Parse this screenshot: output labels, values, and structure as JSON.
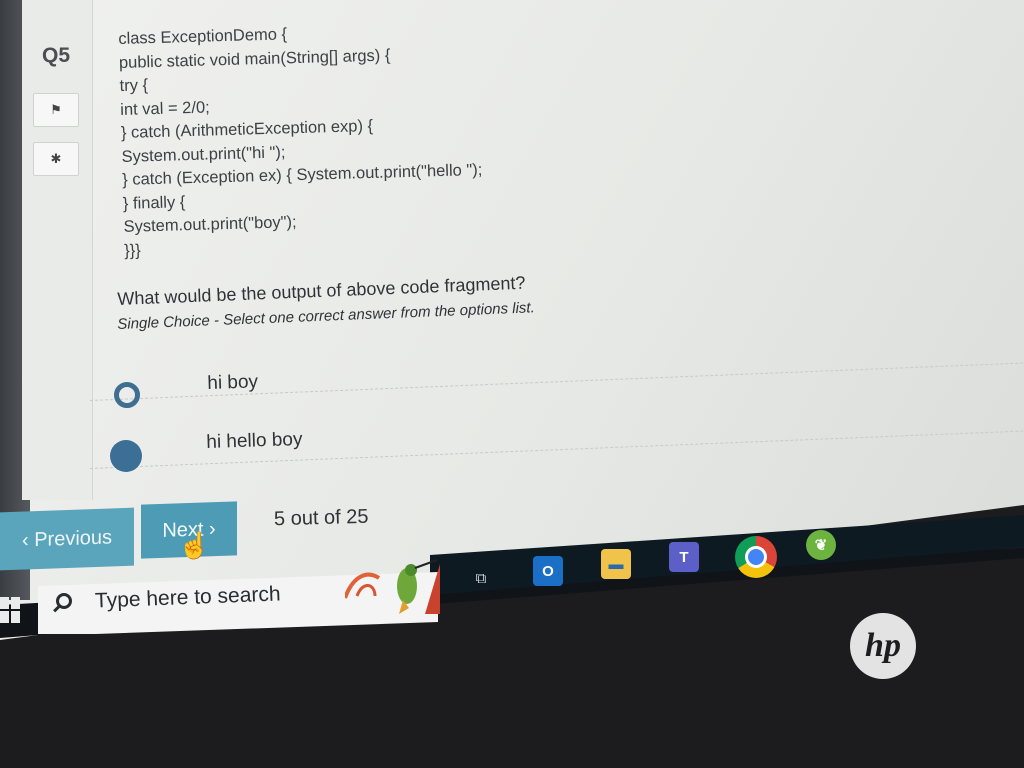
{
  "sidebar": {
    "question_number": "Q5"
  },
  "code_lines": [
    "class ExceptionDemo {",
    "public static void main(String[] args) {",
    "try {",
    "int val = 2/0;",
    "} catch (ArithmeticException exp) {",
    "System.out.print(\"hi \");",
    "} catch (Exception ex) { System.out.print(\"hello \");",
    "} finally {",
    "System.out.print(\"boy\");",
    "}}}"
  ],
  "question": {
    "text": "What would be the output of above code fragment?",
    "instruction": "Single Choice - Select one correct answer from the options list."
  },
  "options": [
    {
      "label": "hi boy",
      "selected": false
    },
    {
      "label": "hi hello boy",
      "selected": true
    }
  ],
  "navigation": {
    "previous_label": "‹ Previous",
    "next_label": "Next ›",
    "progress": "5 out of 25"
  },
  "taskbar": {
    "search_placeholder": "Type here to search",
    "apps": [
      "task-view-icon",
      "outlook-icon",
      "file-explorer-icon",
      "teams-icon",
      "chrome-icon",
      "spring-tool-icon"
    ]
  },
  "brand": {
    "logo": "hp"
  },
  "colors": {
    "accent": "#4d9bb4",
    "radio": "#3b6f96",
    "taskbar": "#101418"
  }
}
